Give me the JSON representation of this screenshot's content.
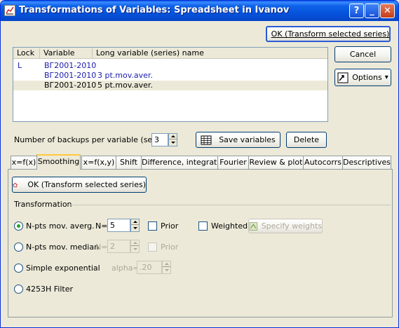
{
  "window": {
    "title": "Transformations of Variables: Spreadsheet in Ivanov",
    "help_label": "?",
    "minimize_label": "_",
    "close_label": "✕"
  },
  "buttons": {
    "ok_top": "OK (Transform selected series)",
    "cancel": "Cancel",
    "options": "Options",
    "options_arrow": "▾",
    "save_variables": "Save variables",
    "delete": "Delete",
    "ok_inner": "OK (Transform selected series)",
    "specify_weights": "Specify weights"
  },
  "list": {
    "headers": [
      "Lock",
      "Variable",
      "Long variable (series) name"
    ],
    "rows": [
      {
        "lock": "L",
        "variable": "BГ2001-2010",
        "name": ""
      },
      {
        "lock": "",
        "variable": "BГ2001-2010",
        "name": "3 pt.mov.aver."
      },
      {
        "lock": "",
        "variable": "BГ2001-2010",
        "name": "5 pt.mov.aver."
      }
    ]
  },
  "backups": {
    "label": "Number of backups per variable (series):",
    "value": "3"
  },
  "tabs": [
    "x=f(x)",
    "Smoothing",
    "x=f(x,y)",
    "Shift",
    "Difference, integrate",
    "Fourier",
    "Review & plot",
    "Autocorrs",
    "Descriptives"
  ],
  "active_tab": "Smoothing",
  "transformation": {
    "group_label": "Transformation",
    "n_pts_avg": {
      "label": "N-pts mov. averg.",
      "n_label": "N=",
      "n_value": "5",
      "prior": "Prior",
      "weighted": "Weighted"
    },
    "n_pts_median": {
      "label": "N-pts mov. median",
      "n_label": "N=",
      "n_value": "2",
      "prior": "Prior"
    },
    "simple_exp": {
      "label": "Simple exponential",
      "alpha_label": "alpha=",
      "alpha_value": ".20"
    },
    "filter_4253h": {
      "label": "4253H Filter"
    }
  }
}
